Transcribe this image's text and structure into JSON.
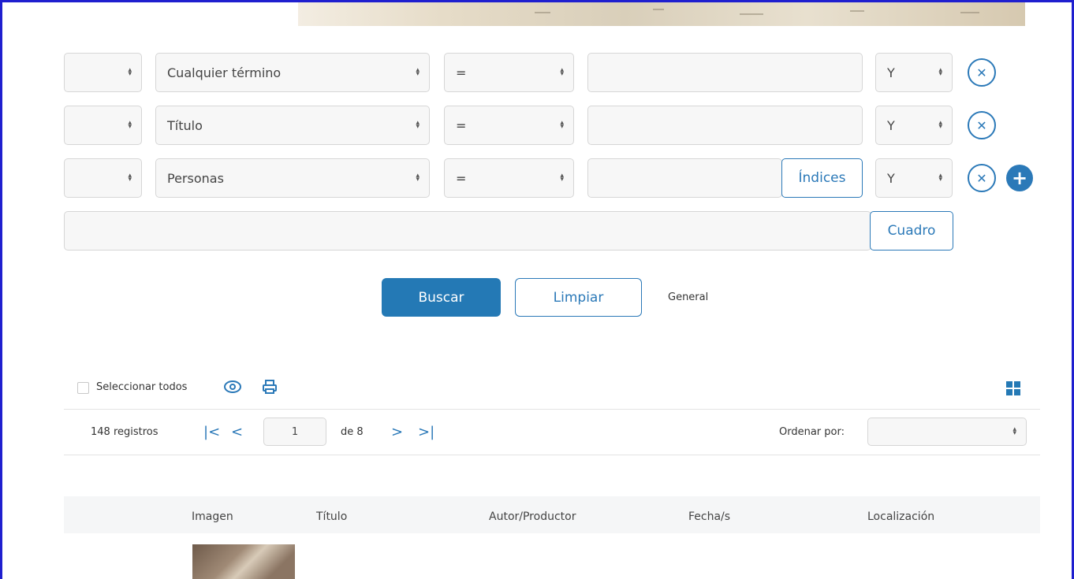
{
  "rows": [
    {
      "field": "Cualquier término",
      "operator": "=",
      "value": "",
      "connector": "Y"
    },
    {
      "field": "Título",
      "operator": "=",
      "value": "",
      "connector": "Y"
    },
    {
      "field": "Personas",
      "operator": "=",
      "value": "",
      "connector": "Y",
      "index_label": "Índices"
    }
  ],
  "frame_button": "Cuadro",
  "actions": {
    "search": "Buscar",
    "clear": "Limpiar",
    "general": "General"
  },
  "toolbar": {
    "select_all": "Seleccionar todos"
  },
  "pagination": {
    "records": "148 registros",
    "page": "1",
    "of": "de 8",
    "sort_label": "Ordenar por:",
    "sort_value": ""
  },
  "table": {
    "headers": [
      "Imagen",
      "Título",
      "Autor/Productor",
      "Fecha/s",
      "Localización"
    ]
  },
  "colors": {
    "accent": "#2479b5",
    "frame_border": "#1f1fcf"
  }
}
